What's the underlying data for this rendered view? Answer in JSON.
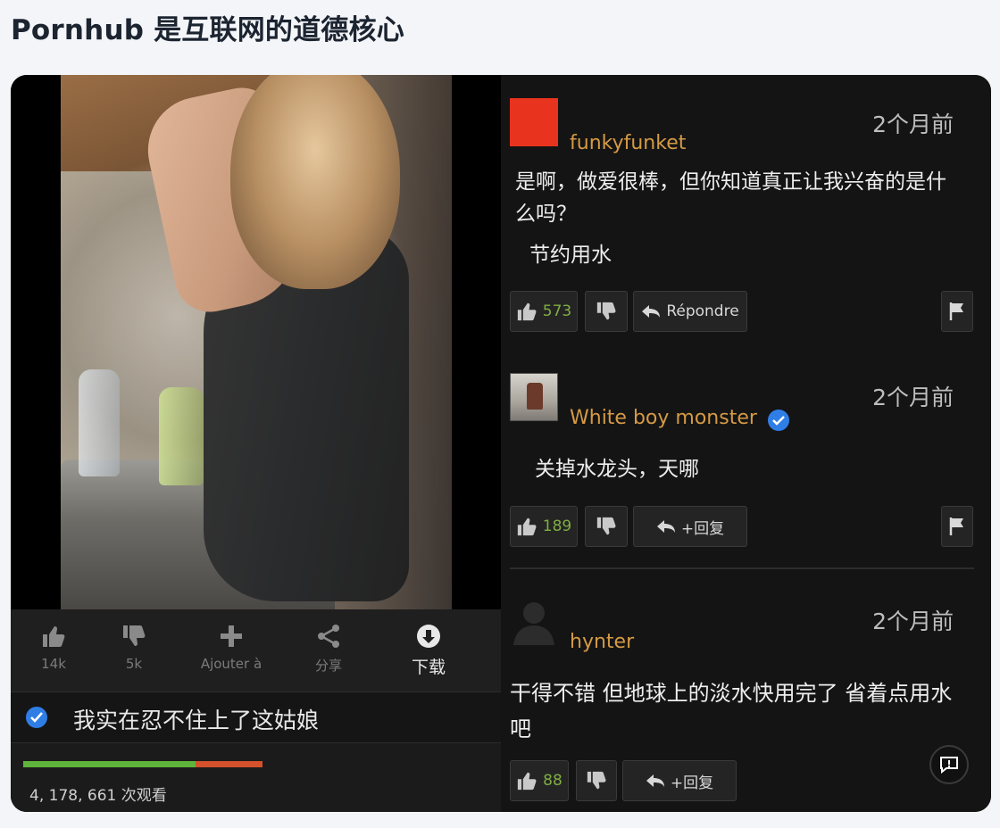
{
  "page": {
    "title": "Pornhub 是互联网的道德核心"
  },
  "video": {
    "actions": [
      {
        "label": "14k",
        "icon": "thumbs-up-icon"
      },
      {
        "label": "5k",
        "icon": "thumbs-down-icon"
      },
      {
        "label": "Ajouter à",
        "icon": "plus-icon"
      },
      {
        "label": "分享",
        "icon": "share-icon"
      },
      {
        "label": "下载",
        "icon": "download-icon"
      }
    ],
    "title": "我实在忍不住上了这姑娘",
    "views": "4, 178, 661 次观看",
    "rating_fraction": 0.72,
    "colors": {
      "good": "#5fb53b",
      "bad": "#d4512c",
      "verified": "#2f7ee6"
    }
  },
  "comments": [
    {
      "username": "funkyfunket",
      "time": "2个月前",
      "text": "是啊，做爱很棒，但你知道真正让我兴奋的是什么吗？",
      "text2": "节约用水",
      "likes": "573",
      "reply_label": "Répondre",
      "avatar": "red-square"
    },
    {
      "username": "White boy monster",
      "verified": true,
      "time": "2个月前",
      "text": "关掉水龙头，天哪",
      "likes": "189",
      "reply_label": "+回复",
      "avatar": "photo"
    },
    {
      "username": "hynter",
      "time": "2个月前",
      "text": "干得不错 但地球上的淡水快用完了 省着点用水吧",
      "likes": "88",
      "reply_label": "+回复",
      "avatar": "silhouette"
    }
  ],
  "colors": {
    "username": "#d59a45",
    "likes": "#7fae42",
    "avatar_red": "#e8331e"
  }
}
